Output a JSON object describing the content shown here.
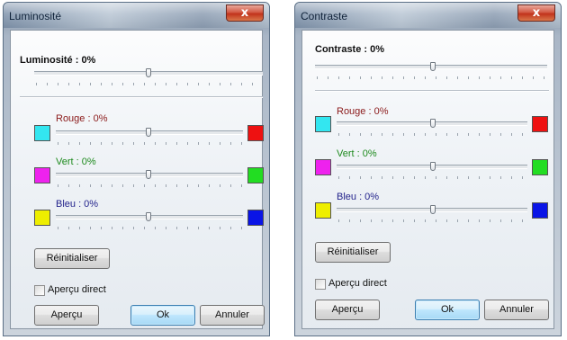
{
  "dialogs": [
    {
      "title": "Luminosité",
      "close_glyph": "x",
      "main_label": "Luminosité : 0%",
      "channels": [
        {
          "label": "Rouge : 0%",
          "label_color": "#8b1a1a",
          "left_color": "#33e6f0",
          "right_color": "#ee1111"
        },
        {
          "label": "Vert : 0%",
          "label_color": "#1d8a1d",
          "left_color": "#ee22ee",
          "right_color": "#22dd22"
        },
        {
          "label": "Bleu : 0%",
          "label_color": "#24248c",
          "left_color": "#eeee00",
          "right_color": "#0a14e6"
        }
      ],
      "reset_label": "Réinitialiser",
      "live_preview_label": "Aperçu direct",
      "live_preview_checked": false,
      "preview_label": "Aperçu",
      "ok_label": "Ok",
      "cancel_label": "Annuler"
    },
    {
      "title": "Contraste",
      "close_glyph": "x",
      "main_label": "Contraste : 0%",
      "channels": [
        {
          "label": "Rouge : 0%",
          "label_color": "#8b1a1a",
          "left_color": "#33e6f0",
          "right_color": "#ee1111"
        },
        {
          "label": "Vert : 0%",
          "label_color": "#1d8a1d",
          "left_color": "#ee22ee",
          "right_color": "#22dd22"
        },
        {
          "label": "Bleu : 0%",
          "label_color": "#24248c",
          "left_color": "#eeee00",
          "right_color": "#0a14e6"
        }
      ],
      "reset_label": "Réinitialiser",
      "live_preview_label": "Aperçu direct",
      "live_preview_checked": false,
      "preview_label": "Aperçu",
      "ok_label": "Ok",
      "cancel_label": "Annuler"
    }
  ],
  "slider_values": {
    "main": 0,
    "rouge": 0,
    "vert": 0,
    "bleu": 0
  }
}
